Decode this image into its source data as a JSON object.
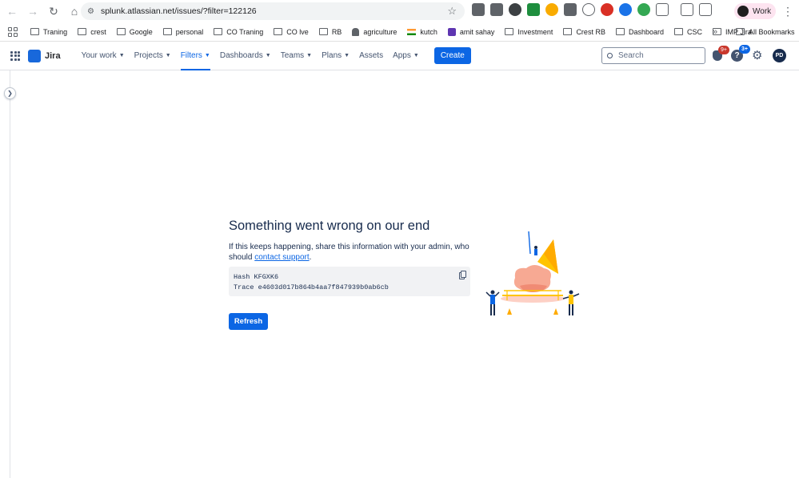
{
  "browser": {
    "url": "splunk.atlassian.net/issues/?filter=122126",
    "profile_label": "Work",
    "bookmarks": [
      "Traning",
      "crest",
      "Google",
      "personal",
      "CO Traning",
      "CO lve",
      "RB",
      "agriculture",
      "kutch",
      "amit sahay",
      "Investment",
      "Crest RB",
      "Dashboard",
      "CSC",
      "IMP Jira"
    ],
    "bookmarks_more": "»",
    "all_bookmarks": "All Bookmarks"
  },
  "jira_nav": {
    "product": "Jira",
    "menu": [
      {
        "label": "Your work",
        "active": false
      },
      {
        "label": "Projects",
        "active": false
      },
      {
        "label": "Filters",
        "active": true
      },
      {
        "label": "Dashboards",
        "active": false
      },
      {
        "label": "Teams",
        "active": false
      },
      {
        "label": "Plans",
        "active": false
      },
      {
        "label": "Assets",
        "active": false
      },
      {
        "label": "Apps",
        "active": false
      }
    ],
    "create_label": "Create",
    "search_placeholder": "Search",
    "notifications_badge": "9+",
    "help_badge": "3+",
    "avatar_initials": "PD"
  },
  "error": {
    "title": "Something went wrong on our end",
    "desc_prefix": "If this keeps happening, share this information with your admin, who should ",
    "desc_link": "contact support",
    "desc_suffix": ".",
    "hash_line": "Hash KFGXK6",
    "trace_line": "Trace e4603d017b864b4aa7f847939b0ab6cb",
    "refresh_label": "Refresh"
  },
  "colors": {
    "brand_blue": "#0C66E4",
    "badge_red": "#C9372C"
  }
}
